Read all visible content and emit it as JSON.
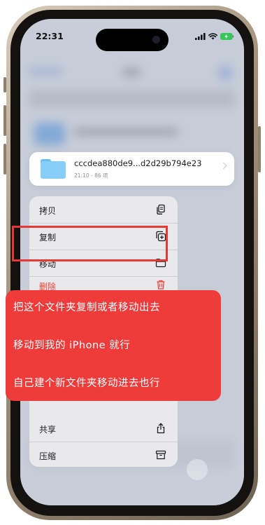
{
  "status": {
    "time": "22:31"
  },
  "file": {
    "name": "cccdea880de9...d2d29b794e23",
    "meta": "21:10 - 86 项"
  },
  "menu": {
    "items": [
      {
        "label": "拷贝",
        "icon": "doc-copy-icon"
      },
      {
        "label": "复制",
        "icon": "duplicate-plus-icon"
      },
      {
        "label": "移动",
        "icon": "folder-icon"
      },
      {
        "label": "删除",
        "icon": "trash-icon"
      },
      {
        "label": "共享",
        "icon": "share-icon"
      },
      {
        "label": "压缩",
        "icon": "archive-box-icon"
      }
    ]
  },
  "overlay": {
    "lines": [
      "把这个文件夹复制或者移动出去",
      "移动到我的 iPhone 就行",
      "自己建个新文件夹移动进去也行"
    ]
  },
  "colors": {
    "delete_red": "#ff3b30",
    "overlay_red": "#f03b3b",
    "highlight_border": "#e83835"
  }
}
